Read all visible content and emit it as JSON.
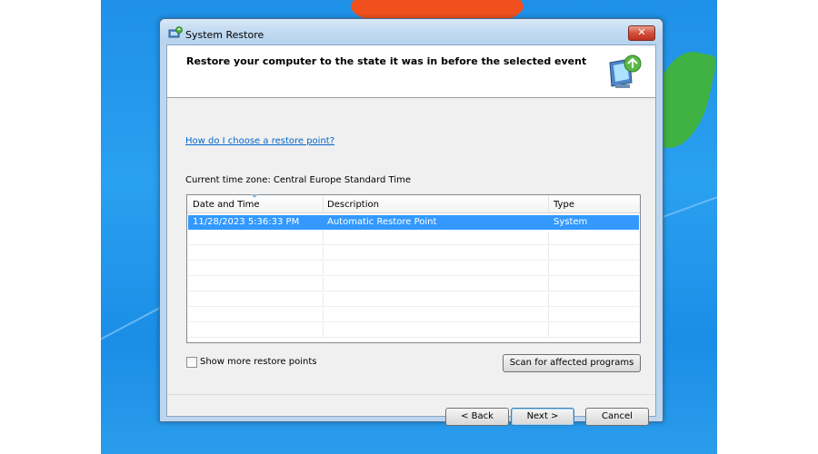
{
  "window": {
    "title": "System Restore",
    "close_symbol": "✕"
  },
  "header": {
    "title": "Restore your computer to the state it was in before the selected event",
    "icon": "system-restore-icon"
  },
  "help_link": "How do I choose a restore point?",
  "timezone_text": "Current time zone: Central Europe Standard Time",
  "restore_list": {
    "columns": [
      "Date and Time",
      "Description",
      "Type"
    ],
    "rows": [
      {
        "date": "11/28/2023 5:36:33 PM",
        "description": "Automatic Restore Point",
        "type": "System",
        "selected": true
      }
    ]
  },
  "show_more_label": "Show more restore points",
  "show_more_checked": false,
  "buttons": {
    "scan": "Scan for affected programs",
    "back": "< Back",
    "next": "Next >",
    "cancel": "Cancel"
  },
  "colors": {
    "selection": "#3399ff",
    "link": "#0066cc",
    "close_button": "#c8402c"
  }
}
